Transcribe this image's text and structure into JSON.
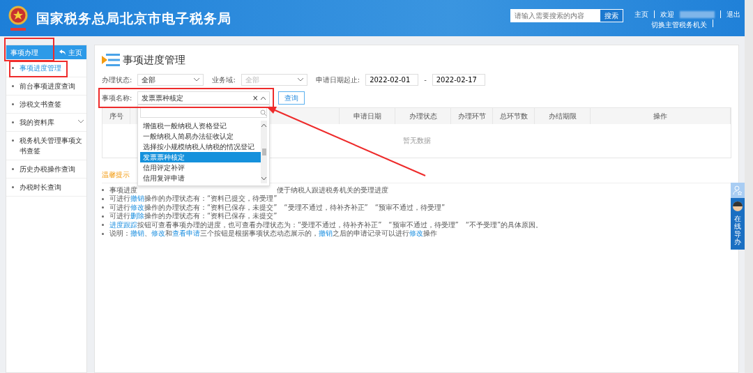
{
  "header": {
    "title": "国家税务总局北京市电子税务局",
    "search": {
      "placeholder": "请输入需要搜索的内容",
      "button": "搜索"
    },
    "links": [
      "主页",
      "欢迎",
      "退出"
    ],
    "switch_link": "切换主管税务机关"
  },
  "sidebar": {
    "title": "事项办理",
    "home": "主页",
    "items": [
      {
        "label": "事项进度管理",
        "selected": true,
        "expandable": false
      },
      {
        "label": "前台事项进度查询",
        "selected": false,
        "expandable": false
      },
      {
        "label": "涉税文书查签",
        "selected": false,
        "expandable": false
      },
      {
        "label": "我的资料库",
        "selected": false,
        "expandable": true
      },
      {
        "label": "税务机关管理事项文书查签",
        "selected": false,
        "expandable": false
      },
      {
        "label": "历史办税操作查询",
        "selected": false,
        "expandable": false
      },
      {
        "label": "办税时长查询",
        "selected": false,
        "expandable": false
      }
    ]
  },
  "page_title": "事项进度管理",
  "filters": {
    "status": {
      "label": "办理状态:",
      "value": "全部",
      "disabled": false
    },
    "domain": {
      "label": "业务域:",
      "value": "全部",
      "disabled": true
    },
    "date": {
      "label": "申请日期起止:",
      "from": "2022-02-01",
      "sep": "-",
      "to": "2022-02-17"
    },
    "name": {
      "label": "事项名称:",
      "value": "发票票种核定",
      "clear": "×"
    },
    "query_button": "查询"
  },
  "dropdown": {
    "items": [
      {
        "label": "增值税一般纳税人资格登记",
        "selected": false
      },
      {
        "label": "一般纳税人简易办法征收认定",
        "selected": false
      },
      {
        "label": "选择按小规模纳税人纳税的情况登记",
        "selected": false
      },
      {
        "label": "发票票种核定",
        "selected": true
      },
      {
        "label": "信用评定补评",
        "selected": false
      },
      {
        "label": "信用复评申请",
        "selected": false
      }
    ]
  },
  "table": {
    "columns": [
      "序号",
      "",
      "申请日期",
      "办理状态",
      "办理环节",
      "总环节数",
      "办结期限",
      "操作"
    ],
    "empty": "暂无数据"
  },
  "tips": {
    "title": "温馨提示",
    "lines": [
      [
        {
          "kind": "text",
          "text": "事项进度"
        },
        {
          "kind": "gap"
        },
        {
          "kind": "text",
          "text": "便于纳税人跟进税务机关的受理进度"
        }
      ],
      [
        {
          "kind": "text",
          "text": "可进行"
        },
        {
          "kind": "link",
          "text": "撤销"
        },
        {
          "kind": "text",
          "text": "操作的办理状态有：“资料已提交，待受理”"
        }
      ],
      [
        {
          "kind": "text",
          "text": "可进行"
        },
        {
          "kind": "link",
          "text": "修改"
        },
        {
          "kind": "text",
          "text": "操作的办理状态有：“资料已保存，未提交”　“受理不通过，待补齐补正”　“预审不通过，待受理”"
        }
      ],
      [
        {
          "kind": "text",
          "text": "可进行"
        },
        {
          "kind": "link",
          "text": "删除"
        },
        {
          "kind": "text",
          "text": "操作的办理状态有：“资料已保存，未提交”"
        }
      ],
      [
        {
          "kind": "link",
          "text": "进度跟踪"
        },
        {
          "kind": "text",
          "text": "按钮可查看事项办理的进度，也可查看办理状态为：“受理不通过，待补齐补正”　“预审不通过，待受理”　“不予受理”的具体原因。"
        }
      ],
      [
        {
          "kind": "text",
          "text": "说明："
        },
        {
          "kind": "link",
          "text": "撤销"
        },
        {
          "kind": "text",
          "text": "、"
        },
        {
          "kind": "link",
          "text": "修改"
        },
        {
          "kind": "text",
          "text": "和"
        },
        {
          "kind": "link",
          "text": "查看申请"
        },
        {
          "kind": "text",
          "text": "三个按钮是根据事项状态动态展示的，"
        },
        {
          "kind": "link",
          "text": "撤销"
        },
        {
          "kind": "text",
          "text": "之后的申请记录可以进行"
        },
        {
          "kind": "link",
          "text": "修改"
        },
        {
          "kind": "text",
          "text": "操作"
        }
      ]
    ]
  },
  "float_widget": {
    "label": "在线导办"
  }
}
